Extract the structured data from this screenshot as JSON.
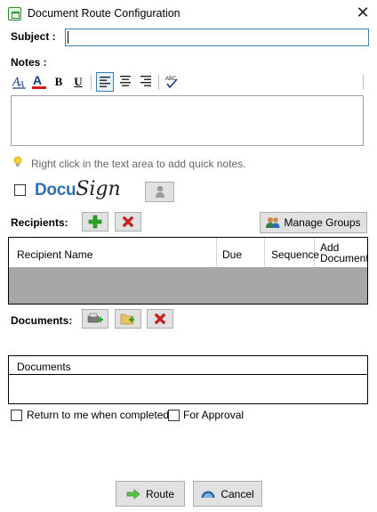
{
  "window": {
    "title": "Document Route Configuration"
  },
  "subject": {
    "label": "Subject :",
    "value": ""
  },
  "notes": {
    "label": "Notes :",
    "value": "",
    "hint": "Right click in the text area to add quick notes."
  },
  "docusign": {
    "checked": false,
    "logo_text_docu": "Docu",
    "logo_text_sign": "Sign"
  },
  "recipients": {
    "label": "Recipients:",
    "manage_groups_label": "Manage Groups",
    "columns": [
      "Recipient Name",
      "Due",
      "Sequence",
      "Add Documents"
    ],
    "rows": []
  },
  "documents": {
    "label": "Documents:",
    "columns": [
      "Documents"
    ],
    "rows": []
  },
  "options": {
    "return_label": "Return to me when completed",
    "return_checked": false,
    "approval_label": "For Approval",
    "approval_checked": false
  },
  "footer": {
    "route_label": "Route",
    "cancel_label": "Cancel"
  },
  "colors": {
    "accent": "#3c7fb1",
    "docusign_blue": "#2e6fb7",
    "add_green": "#26a526",
    "remove_red": "#d21d1d",
    "grid_gray": "#a7a7a7"
  }
}
